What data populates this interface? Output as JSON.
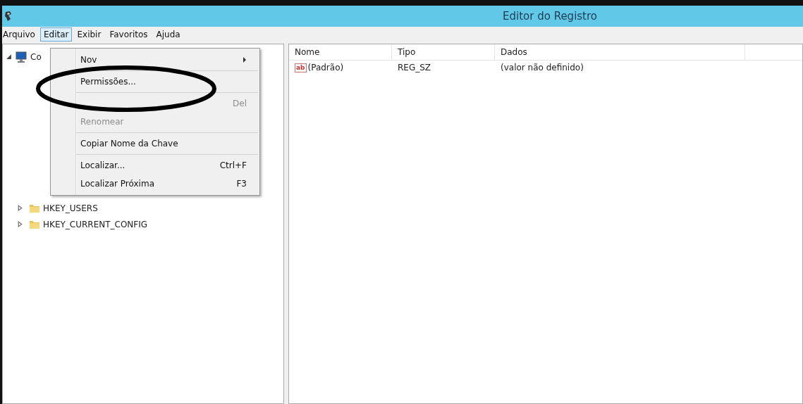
{
  "window": {
    "title": "Editor do Registro"
  },
  "menu_bar": [
    {
      "label": "Arquivo",
      "selected": false
    },
    {
      "label": "Editar",
      "selected": true
    },
    {
      "label": "Exibir",
      "selected": false
    },
    {
      "label": "Favoritos",
      "selected": false
    },
    {
      "label": "Ajuda",
      "selected": false
    }
  ],
  "tree": {
    "root": {
      "label": "Co",
      "expanded": true
    },
    "items": [
      {
        "label": "HKEY_USERS",
        "expanded": false
      },
      {
        "label": "HKEY_CURRENT_CONFIG",
        "expanded": false
      }
    ]
  },
  "edit_menu": [
    {
      "kind": "item",
      "label": "Nov",
      "submenu": true,
      "disabled": false
    },
    {
      "kind": "separator"
    },
    {
      "kind": "item",
      "label": "Permissões...",
      "submenu": false,
      "disabled": false
    },
    {
      "kind": "separator"
    },
    {
      "kind": "item",
      "shortcut": "Del",
      "submenu": false,
      "disabled": true
    },
    {
      "kind": "item",
      "label": "Renomear",
      "submenu": false,
      "disabled": true
    },
    {
      "kind": "separator"
    },
    {
      "kind": "item",
      "label": "Copiar Nome da Chave",
      "submenu": false,
      "disabled": false
    },
    {
      "kind": "separator"
    },
    {
      "kind": "item",
      "label": "Localizar...",
      "shortcut": "Ctrl+F",
      "submenu": false,
      "disabled": false
    },
    {
      "kind": "item",
      "label": "Localizar Próxima",
      "shortcut": "F3",
      "submenu": false,
      "disabled": false
    }
  ],
  "table": {
    "columns": [
      "Nome",
      "Tipo",
      "Dados"
    ],
    "rows": [
      {
        "icon": "ab",
        "name": "(Padrão)",
        "type": "REG_SZ",
        "data": "(valor não definido)"
      }
    ]
  }
}
